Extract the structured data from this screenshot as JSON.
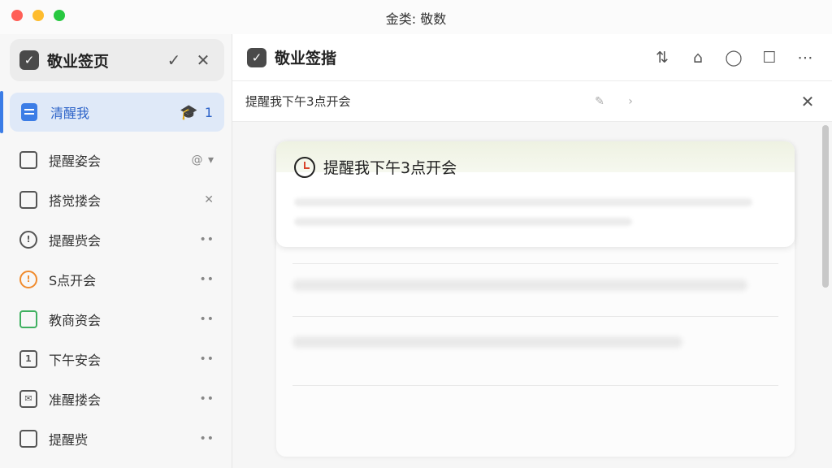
{
  "window": {
    "title": "金类: 敬数"
  },
  "sidebar": {
    "header_title": "敬业签页",
    "active_item": {
      "label": "清醒我",
      "badge_count": "1",
      "icon": "note-icon"
    },
    "items": [
      {
        "label": "提醒姿会",
        "icon": "document-icon",
        "trail": "@ ▾"
      },
      {
        "label": "搭觉搂会",
        "icon": "square-icon",
        "trail": "✕"
      },
      {
        "label": "提醒赀会",
        "icon": "info-circle-icon",
        "trail": "••"
      },
      {
        "label": "S点开会",
        "icon": "alert-icon",
        "trail": "••"
      },
      {
        "label": "教商资会",
        "icon": "calendar-green-icon",
        "trail": "••"
      },
      {
        "label": "下午安会",
        "icon": "calendar-icon",
        "trail": "••"
      },
      {
        "label": "准醒搂会",
        "icon": "mail-icon",
        "trail": "••"
      },
      {
        "label": "提醒赀",
        "icon": "square-icon",
        "trail": "••"
      }
    ]
  },
  "main": {
    "title": "敬业签揩",
    "toolbar": [
      "sort-icon",
      "bell-icon",
      "chat-icon",
      "message-icon",
      "more-icon"
    ],
    "sub_title": "提醒我下午3点开会",
    "reminder": {
      "text": "提醒我下午3点开会",
      "icon": "alarm-icon"
    }
  },
  "colors": {
    "accent": "#3c7de6",
    "active_bg": "#dfe9f8",
    "orange": "#f08a2c",
    "green": "#3fb060"
  }
}
